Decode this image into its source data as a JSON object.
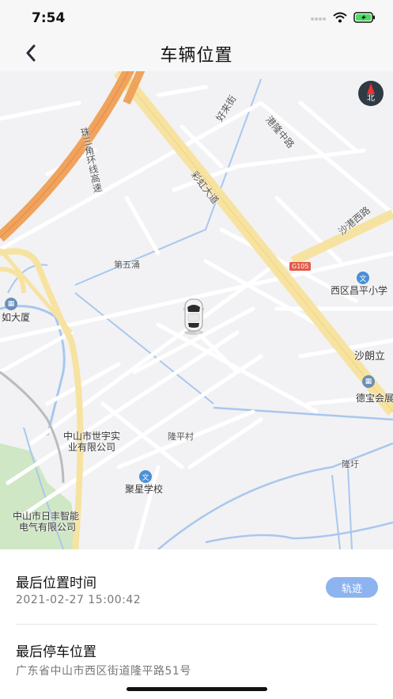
{
  "status_bar": {
    "time": "7:54"
  },
  "nav": {
    "title": "车辆位置"
  },
  "map": {
    "labels": {
      "zhusanjiao": "珠三角环线高速",
      "haolai": "好来街",
      "ganglong": "港隆中路",
      "caihong": "彩虹大道",
      "shagang": "沙港西路",
      "diwuyong": "第五涌",
      "g105": "G105",
      "xiqu_changping": "西区昌平小学",
      "rudasha": "如大厦",
      "shalang": "沙朗立",
      "debao": "德宝会展",
      "shiyu_line1": "中山市世宇实",
      "shiyu_line2": "业有限公司",
      "longping_cun": "隆平村",
      "longyu": "隆圩",
      "juxing": "聚星学校",
      "rifeng_line1": "中山市日丰智能",
      "rifeng_line2": "电气有限公司"
    },
    "compass_label": "北"
  },
  "info": {
    "last_time_label": "最后位置时间",
    "last_time_value": "2021-02-27 15:00:42",
    "track_button": "轨迹",
    "last_park_label": "最后停车位置",
    "last_park_value": "广东省中山市西区街道隆平路51号"
  },
  "colors": {
    "track_button_bg": "#8db4ef",
    "highway": "#f0a35c",
    "major_road": "#f7e3a1",
    "water": "#a9c7ee",
    "green": "#cfe7c4"
  }
}
